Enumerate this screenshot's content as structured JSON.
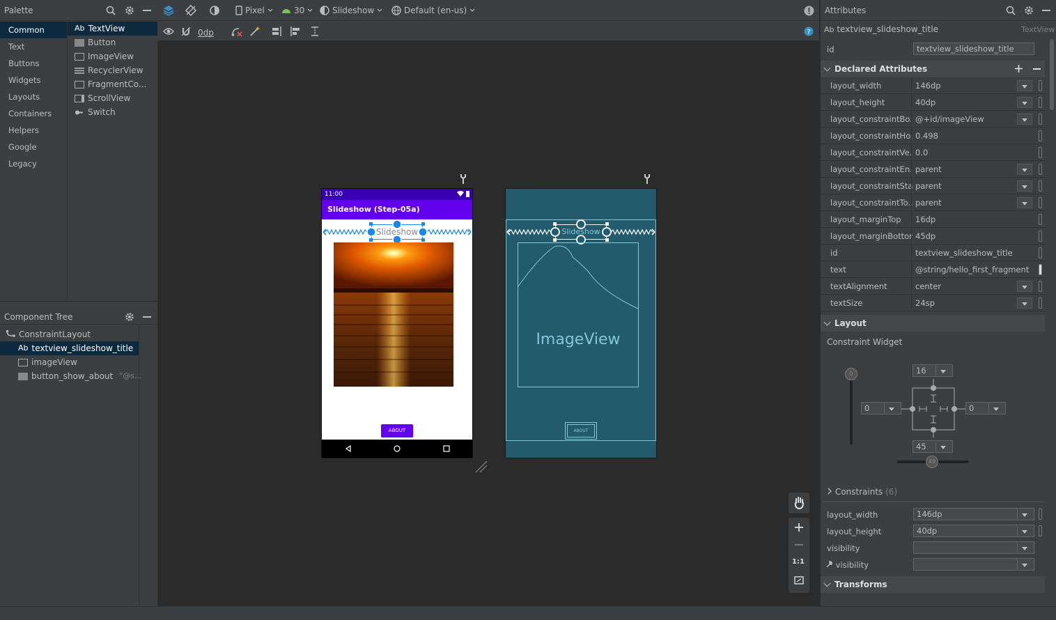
{
  "palette": {
    "title": "Palette",
    "categories": [
      "Common",
      "Text",
      "Buttons",
      "Widgets",
      "Layouts",
      "Containers",
      "Helpers",
      "Google",
      "Legacy"
    ],
    "items": [
      {
        "icon": "text-ab-icon",
        "label": "TextView",
        "prefix": "Ab"
      },
      {
        "icon": "button-icon",
        "label": "Button"
      },
      {
        "icon": "image-icon",
        "label": "ImageView"
      },
      {
        "icon": "list-icon",
        "label": "RecyclerView"
      },
      {
        "icon": "fragment-icon",
        "label": "FragmentCo..."
      },
      {
        "icon": "scroll-icon",
        "label": "ScrollView"
      },
      {
        "icon": "switch-icon",
        "label": "Switch"
      }
    ]
  },
  "tree": {
    "title": "Component Tree",
    "items": [
      {
        "label": "ConstraintLayout",
        "icon": "constraint-icon"
      },
      {
        "label": "textview_slideshow_title",
        "prefix": "Ab",
        "icon": "text-ab-icon"
      },
      {
        "label": "imageView",
        "icon": "image-icon"
      },
      {
        "label": "button_show_about",
        "suffix": "\"@s...",
        "icon": "button-icon"
      }
    ]
  },
  "toolbar": {
    "device": "Pixel",
    "api": "30",
    "theme": "Slideshow",
    "locale": "Default (en-us)",
    "margin": "0dp"
  },
  "phone": {
    "time": "11:00",
    "app_title": "Slideshow (Step-05a)",
    "title_text": "Slideshow",
    "button_text": "ABOUT",
    "accent": "#6200ee"
  },
  "blueprint": {
    "title_text": "Slideshow",
    "image_label": "ImageView",
    "button_text": "ABOUT"
  },
  "attributes": {
    "title": "Attributes",
    "component_prefix": "Ab",
    "component_id": "textview_slideshow_title",
    "component_type": "TextView",
    "id_label": "id",
    "id_value": "textview_slideshow_title",
    "declared_title": "Declared Attributes",
    "declared": [
      {
        "name": "layout_width",
        "value": "146dp",
        "dropdown": true
      },
      {
        "name": "layout_height",
        "value": "40dp",
        "dropdown": true
      },
      {
        "name": "layout_constraintBo...",
        "value": "@+id/imageView",
        "dropdown": true
      },
      {
        "name": "layout_constraintHo...",
        "value": "0.498",
        "dropdown": false
      },
      {
        "name": "layout_constraintVe...",
        "value": "0.0",
        "dropdown": false
      },
      {
        "name": "layout_constraintEn...",
        "value": "parent",
        "dropdown": true
      },
      {
        "name": "layout_constraintSta...",
        "value": "parent",
        "dropdown": true
      },
      {
        "name": "layout_constraintTo...",
        "value": "parent",
        "dropdown": true
      },
      {
        "name": "layout_marginTop",
        "value": "16dp",
        "dropdown": false
      },
      {
        "name": "layout_marginBottom",
        "value": "45dp",
        "dropdown": false
      },
      {
        "name": "id",
        "value": "textview_slideshow_title",
        "dropdown": false
      },
      {
        "name": "text",
        "value": "@string/hello_first_fragment",
        "dropdown": false
      },
      {
        "name": "textAlignment",
        "value": "center",
        "dropdown": true
      },
      {
        "name": "textSize",
        "value": "24sp",
        "dropdown": true
      }
    ],
    "layout_title": "Layout",
    "constraint_widget": "Constraint Widget",
    "cw_top": "16",
    "cw_left": "0",
    "cw_right": "0",
    "cw_bottom": "45",
    "vbias": "0",
    "hbias": "49",
    "constraints_label": "Constraints",
    "constraints_count": "(6)",
    "bottom_rows": [
      {
        "name": "layout_width",
        "value": "146dp"
      },
      {
        "name": "layout_height",
        "value": "40dp"
      },
      {
        "name": "visibility",
        "value": ""
      },
      {
        "name": "visibility",
        "value": ""
      }
    ],
    "transforms_title": "Transforms"
  },
  "zoom": {
    "one_to_one": "1:1"
  }
}
